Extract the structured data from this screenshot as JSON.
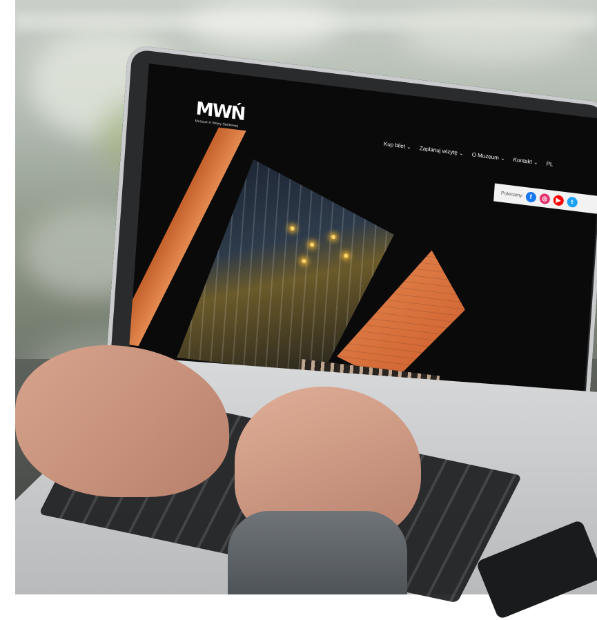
{
  "site": {
    "logo_text": "MWŃ",
    "logo_subtitle": "Muzeum II Wojny Światowej",
    "nav": [
      "Kup bilet ⌄",
      "Zaplanuj wizytę ⌄",
      "O Muzeum ⌄",
      "Kontakt ⌄",
      "PL"
    ],
    "social_label": "Polecamy",
    "social_icons": [
      {
        "name": "facebook-icon",
        "glyph": "f",
        "color": "#1877f2"
      },
      {
        "name": "instagram-icon",
        "glyph": "◎",
        "color": "#e1306c"
      },
      {
        "name": "youtube-icon",
        "glyph": "▶",
        "color": "#ff0000"
      },
      {
        "name": "twitter-icon",
        "glyph": "t",
        "color": "#1da1f2"
      }
    ]
  }
}
